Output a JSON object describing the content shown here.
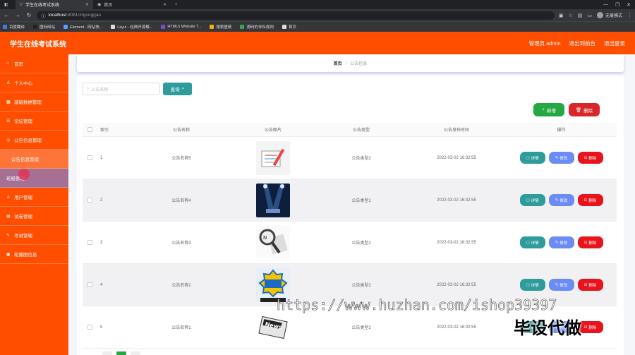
{
  "browser": {
    "tabs": [
      {
        "title": "学生在线考试系统",
        "active": true
      },
      {
        "title": "首页",
        "active": false
      }
    ],
    "new_tab": "+",
    "url_host": "localhost",
    "url_path": ":8081/#/gonggao",
    "profile_label": "无痕模式",
    "bookmarks": [
      {
        "label": "百度翻译",
        "color": "#3b7ddd"
      },
      {
        "label": "图标网站",
        "color": "#222222"
      },
      {
        "label": "Element - 网站快...",
        "color": "#4aa3ff"
      },
      {
        "label": "Layui - 经典开源模...",
        "color": "#dddddd"
      },
      {
        "label": "HTML5 Website T...",
        "color": "#7a4ccf"
      },
      {
        "label": "搜索壁纸",
        "color": "#f0b400"
      },
      {
        "label": "源码的非私规则",
        "color": "#33a852"
      },
      {
        "label": "首页",
        "color": "#dddddd"
      }
    ]
  },
  "header": {
    "title": "学生在线考试系统",
    "user_label": "管理员 admin",
    "backend_link": "退出到前台",
    "logout_link": "退出登录"
  },
  "sidebar": {
    "items": [
      {
        "label": "首页",
        "icon": "home-icon"
      },
      {
        "label": "个人中心",
        "icon": "user-icon"
      },
      {
        "label": "基础数据管理",
        "icon": "grid-icon"
      },
      {
        "label": "论坛管理",
        "icon": "forum-icon"
      },
      {
        "label": "公告信息管理",
        "icon": "notice-icon"
      },
      {
        "label": "公告信息管理",
        "icon": "",
        "sub": true
      },
      {
        "label": "班级管理",
        "icon": "",
        "hover": true
      },
      {
        "label": "用户管理",
        "icon": "users-icon"
      },
      {
        "label": "试卷管理",
        "icon": "paper-icon"
      },
      {
        "label": "考试管理",
        "icon": "exam-icon"
      },
      {
        "label": "轮播图信息",
        "icon": "image-icon"
      }
    ]
  },
  "breadcrumb": {
    "home": "首页",
    "separator": "/",
    "current": "公告信息"
  },
  "search": {
    "placeholder": "公告名称",
    "button_label": "查询"
  },
  "toolbar": {
    "add_label": "新增",
    "delete_label": "删除"
  },
  "table": {
    "columns": [
      "索引",
      "公告名称",
      "公告图片",
      "公告类型",
      "公告发布时间",
      "操作"
    ],
    "rows": [
      {
        "index": "1",
        "name": "公告名称5",
        "type": "公告类型2",
        "time": "2022-03-02 16:32:55",
        "image": "stationery-image"
      },
      {
        "index": "2",
        "name": "公告名称4",
        "type": "公告类型1",
        "time": "2022-03-02 16:32:55",
        "image": "stage-image"
      },
      {
        "index": "3",
        "name": "公告名称3",
        "type": "公告类型2",
        "time": "2022-03-02 16:32:55",
        "image": "magnifier-news-image"
      },
      {
        "index": "4",
        "name": "公告名称2",
        "type": "公告类型2",
        "time": "2022-03-02 16:32:55",
        "image": "hot-news-image"
      },
      {
        "index": "5",
        "name": "公告名称1",
        "type": "公告类型2",
        "time": "2022-03-02 16:32:55",
        "image": "news-paper-image"
      }
    ],
    "actions": {
      "detail": "详情",
      "edit": "修改",
      "remove": "删除"
    }
  },
  "watermark": {
    "url": "https://www.huzhan.com/ishop39397",
    "slogan": "毕设代做"
  },
  "colors": {
    "brand": "#ff4e00",
    "teal": "#2d9c9b",
    "green": "#24a844",
    "red": "#d9262b",
    "blue": "#6b8cf5"
  }
}
